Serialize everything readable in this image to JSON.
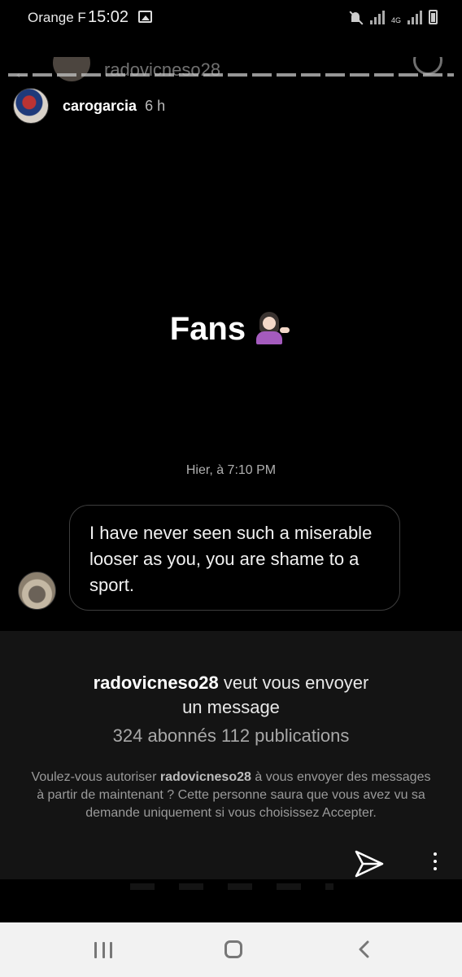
{
  "status_bar": {
    "carrier": "Orange F",
    "time": "15:02",
    "network_type": "4G"
  },
  "background_header": {
    "username": "radovicneso28"
  },
  "story": {
    "username": "carogarcia",
    "age": "6 h",
    "caption": "Fans",
    "emoji": "person-tipping-hand-icon"
  },
  "conversation": {
    "timestamp": "Hier, à 7:10 PM",
    "message": "I have never seen such a miserable looser as you, you are shame to a sport."
  },
  "request": {
    "username": "radovicneso28",
    "title_suffix_line1": " veut vous envoyer",
    "title_line2": "un message",
    "stats": "324 abonnés 112 publications",
    "desc_prefix": "Voulez-vous autoriser ",
    "desc_username": "radovicneso28",
    "desc_suffix": " à vous envoyer des messages à partir de maintenant ? Cette personne saura que vous avez vu sa demande uniquement si vous choisissez Accepter."
  },
  "colors": {
    "background": "#000000",
    "panel": "#141414",
    "bubble_border": "#3d3d3d",
    "navbar": "#f2f2f2"
  }
}
